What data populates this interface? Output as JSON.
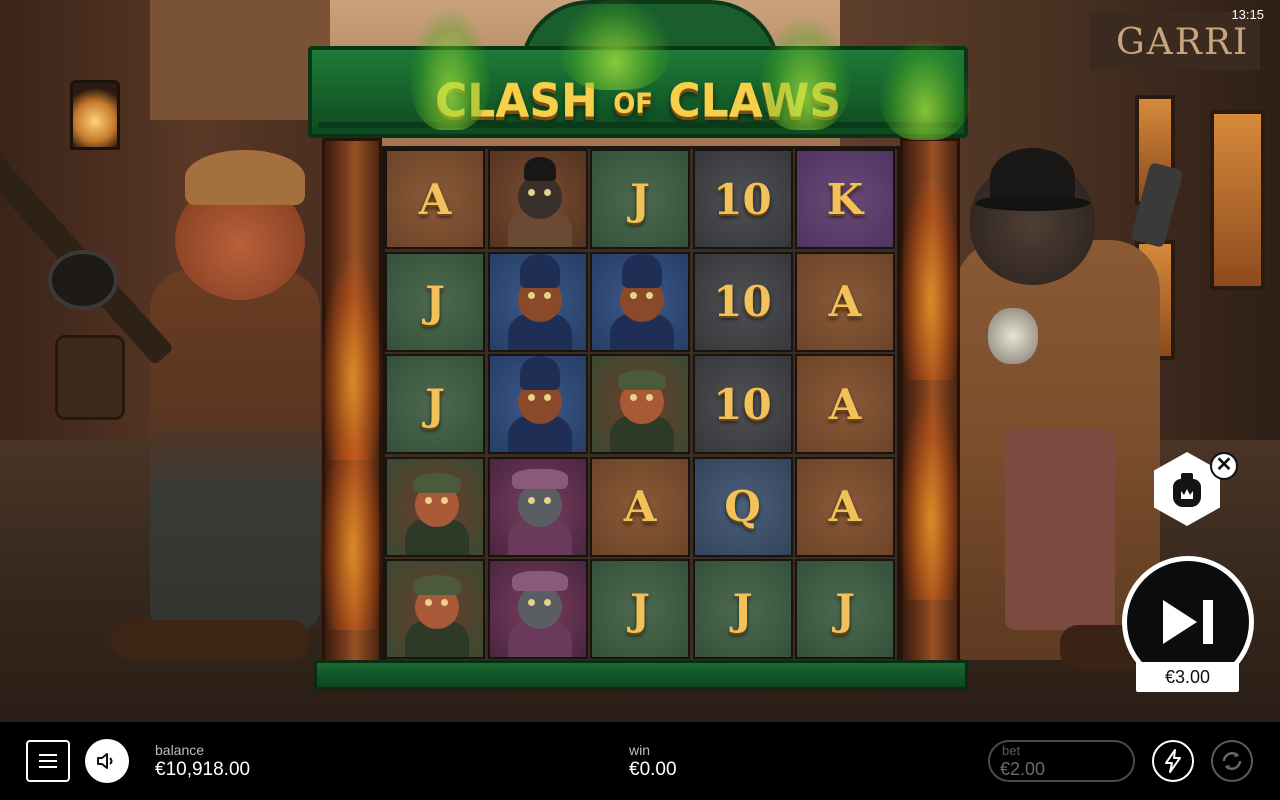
{
  "game": {
    "title_main_1": "CLASH",
    "title_of": "OF",
    "title_main_2": "CLAWS",
    "sign_text": "GARRI"
  },
  "status": {
    "clock": "13:15"
  },
  "reels": {
    "rows": [
      [
        {
          "symbol": "A",
          "type": "letter",
          "bg": "brown"
        },
        {
          "symbol": "bulldog-bowler",
          "type": "character",
          "bg": "rat"
        },
        {
          "symbol": "J",
          "type": "letter",
          "bg": "green"
        },
        {
          "symbol": "10",
          "type": "letter",
          "bg": "gray"
        },
        {
          "symbol": "K",
          "type": "letter",
          "bg": "purple"
        }
      ],
      [
        {
          "symbol": "J",
          "type": "letter",
          "bg": "green"
        },
        {
          "symbol": "police-hound",
          "type": "character",
          "bg": "police"
        },
        {
          "symbol": "police-hound",
          "type": "character",
          "bg": "police"
        },
        {
          "symbol": "10",
          "type": "letter",
          "bg": "gray"
        },
        {
          "symbol": "A",
          "type": "letter",
          "bg": "brown"
        }
      ],
      [
        {
          "symbol": "J",
          "type": "letter",
          "bg": "green"
        },
        {
          "symbol": "police-hound",
          "type": "character",
          "bg": "police"
        },
        {
          "symbol": "cat-gangster",
          "type": "character",
          "bg": "cat"
        },
        {
          "symbol": "10",
          "type": "letter",
          "bg": "gray"
        },
        {
          "symbol": "A",
          "type": "letter",
          "bg": "brown"
        }
      ],
      [
        {
          "symbol": "cat-gangster",
          "type": "character",
          "bg": "cat"
        },
        {
          "symbol": "grey-cat-fedora",
          "type": "character",
          "bg": "fox"
        },
        {
          "symbol": "A",
          "type": "letter",
          "bg": "brown"
        },
        {
          "symbol": "Q",
          "type": "letter",
          "bg": "blue"
        },
        {
          "symbol": "A",
          "type": "letter",
          "bg": "brown"
        }
      ],
      [
        {
          "symbol": "cat-gangster",
          "type": "character",
          "bg": "cat"
        },
        {
          "symbol": "grey-cat-fedora",
          "type": "character",
          "bg": "fox"
        },
        {
          "symbol": "J",
          "type": "letter",
          "bg": "green"
        },
        {
          "symbol": "J",
          "type": "letter",
          "bg": "green"
        },
        {
          "symbol": "J",
          "type": "letter",
          "bg": "green"
        }
      ]
    ]
  },
  "controls": {
    "feature_buy_icon": "money-bag-icon",
    "close_glyph": "✕",
    "spin_icon": "skip-forward-icon",
    "spin_bet": "€3.00"
  },
  "bottombar": {
    "menu_icon": "hamburger-icon",
    "sound_icon": "speaker-icon",
    "balance_label": "balance",
    "balance_value": "€10,918.00",
    "win_label": "win",
    "win_value": "€0.00",
    "bet_label": "bet",
    "bet_value": "€2.00",
    "turbo_icon": "lightning-icon",
    "autoplay_icon": "autoplay-icon"
  },
  "colors": {
    "title_gold": "#f7d04a",
    "frame_green": "#15602b",
    "letter_gold": "#f3c15a"
  }
}
